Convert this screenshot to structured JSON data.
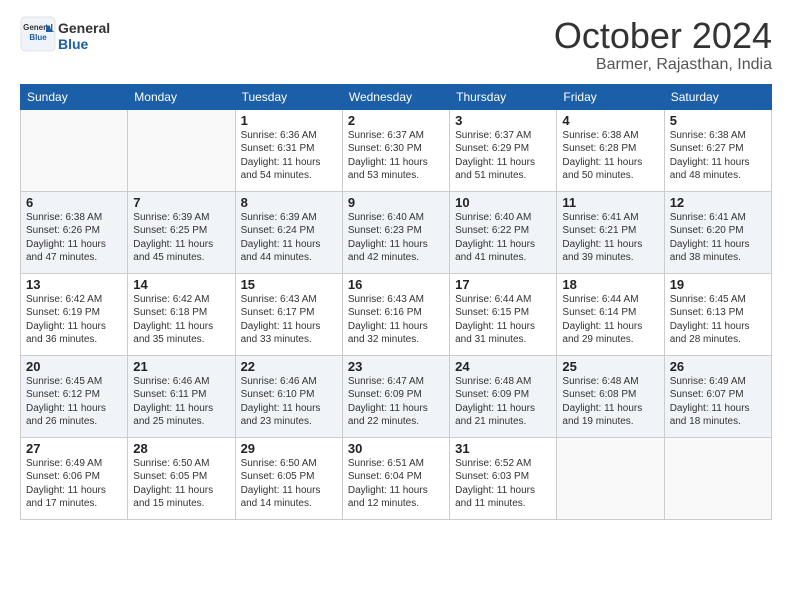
{
  "header": {
    "logo_general": "General",
    "logo_blue": "Blue",
    "month": "October 2024",
    "location": "Barmer, Rajasthan, India"
  },
  "weekdays": [
    "Sunday",
    "Monday",
    "Tuesday",
    "Wednesday",
    "Thursday",
    "Friday",
    "Saturday"
  ],
  "weeks": [
    [
      {
        "day": "",
        "sunrise": "",
        "sunset": "",
        "daylight": ""
      },
      {
        "day": "",
        "sunrise": "",
        "sunset": "",
        "daylight": ""
      },
      {
        "day": "1",
        "sunrise": "Sunrise: 6:36 AM",
        "sunset": "Sunset: 6:31 PM",
        "daylight": "Daylight: 11 hours and 54 minutes."
      },
      {
        "day": "2",
        "sunrise": "Sunrise: 6:37 AM",
        "sunset": "Sunset: 6:30 PM",
        "daylight": "Daylight: 11 hours and 53 minutes."
      },
      {
        "day": "3",
        "sunrise": "Sunrise: 6:37 AM",
        "sunset": "Sunset: 6:29 PM",
        "daylight": "Daylight: 11 hours and 51 minutes."
      },
      {
        "day": "4",
        "sunrise": "Sunrise: 6:38 AM",
        "sunset": "Sunset: 6:28 PM",
        "daylight": "Daylight: 11 hours and 50 minutes."
      },
      {
        "day": "5",
        "sunrise": "Sunrise: 6:38 AM",
        "sunset": "Sunset: 6:27 PM",
        "daylight": "Daylight: 11 hours and 48 minutes."
      }
    ],
    [
      {
        "day": "6",
        "sunrise": "Sunrise: 6:38 AM",
        "sunset": "Sunset: 6:26 PM",
        "daylight": "Daylight: 11 hours and 47 minutes."
      },
      {
        "day": "7",
        "sunrise": "Sunrise: 6:39 AM",
        "sunset": "Sunset: 6:25 PM",
        "daylight": "Daylight: 11 hours and 45 minutes."
      },
      {
        "day": "8",
        "sunrise": "Sunrise: 6:39 AM",
        "sunset": "Sunset: 6:24 PM",
        "daylight": "Daylight: 11 hours and 44 minutes."
      },
      {
        "day": "9",
        "sunrise": "Sunrise: 6:40 AM",
        "sunset": "Sunset: 6:23 PM",
        "daylight": "Daylight: 11 hours and 42 minutes."
      },
      {
        "day": "10",
        "sunrise": "Sunrise: 6:40 AM",
        "sunset": "Sunset: 6:22 PM",
        "daylight": "Daylight: 11 hours and 41 minutes."
      },
      {
        "day": "11",
        "sunrise": "Sunrise: 6:41 AM",
        "sunset": "Sunset: 6:21 PM",
        "daylight": "Daylight: 11 hours and 39 minutes."
      },
      {
        "day": "12",
        "sunrise": "Sunrise: 6:41 AM",
        "sunset": "Sunset: 6:20 PM",
        "daylight": "Daylight: 11 hours and 38 minutes."
      }
    ],
    [
      {
        "day": "13",
        "sunrise": "Sunrise: 6:42 AM",
        "sunset": "Sunset: 6:19 PM",
        "daylight": "Daylight: 11 hours and 36 minutes."
      },
      {
        "day": "14",
        "sunrise": "Sunrise: 6:42 AM",
        "sunset": "Sunset: 6:18 PM",
        "daylight": "Daylight: 11 hours and 35 minutes."
      },
      {
        "day": "15",
        "sunrise": "Sunrise: 6:43 AM",
        "sunset": "Sunset: 6:17 PM",
        "daylight": "Daylight: 11 hours and 33 minutes."
      },
      {
        "day": "16",
        "sunrise": "Sunrise: 6:43 AM",
        "sunset": "Sunset: 6:16 PM",
        "daylight": "Daylight: 11 hours and 32 minutes."
      },
      {
        "day": "17",
        "sunrise": "Sunrise: 6:44 AM",
        "sunset": "Sunset: 6:15 PM",
        "daylight": "Daylight: 11 hours and 31 minutes."
      },
      {
        "day": "18",
        "sunrise": "Sunrise: 6:44 AM",
        "sunset": "Sunset: 6:14 PM",
        "daylight": "Daylight: 11 hours and 29 minutes."
      },
      {
        "day": "19",
        "sunrise": "Sunrise: 6:45 AM",
        "sunset": "Sunset: 6:13 PM",
        "daylight": "Daylight: 11 hours and 28 minutes."
      }
    ],
    [
      {
        "day": "20",
        "sunrise": "Sunrise: 6:45 AM",
        "sunset": "Sunset: 6:12 PM",
        "daylight": "Daylight: 11 hours and 26 minutes."
      },
      {
        "day": "21",
        "sunrise": "Sunrise: 6:46 AM",
        "sunset": "Sunset: 6:11 PM",
        "daylight": "Daylight: 11 hours and 25 minutes."
      },
      {
        "day": "22",
        "sunrise": "Sunrise: 6:46 AM",
        "sunset": "Sunset: 6:10 PM",
        "daylight": "Daylight: 11 hours and 23 minutes."
      },
      {
        "day": "23",
        "sunrise": "Sunrise: 6:47 AM",
        "sunset": "Sunset: 6:09 PM",
        "daylight": "Daylight: 11 hours and 22 minutes."
      },
      {
        "day": "24",
        "sunrise": "Sunrise: 6:48 AM",
        "sunset": "Sunset: 6:09 PM",
        "daylight": "Daylight: 11 hours and 21 minutes."
      },
      {
        "day": "25",
        "sunrise": "Sunrise: 6:48 AM",
        "sunset": "Sunset: 6:08 PM",
        "daylight": "Daylight: 11 hours and 19 minutes."
      },
      {
        "day": "26",
        "sunrise": "Sunrise: 6:49 AM",
        "sunset": "Sunset: 6:07 PM",
        "daylight": "Daylight: 11 hours and 18 minutes."
      }
    ],
    [
      {
        "day": "27",
        "sunrise": "Sunrise: 6:49 AM",
        "sunset": "Sunset: 6:06 PM",
        "daylight": "Daylight: 11 hours and 17 minutes."
      },
      {
        "day": "28",
        "sunrise": "Sunrise: 6:50 AM",
        "sunset": "Sunset: 6:05 PM",
        "daylight": "Daylight: 11 hours and 15 minutes."
      },
      {
        "day": "29",
        "sunrise": "Sunrise: 6:50 AM",
        "sunset": "Sunset: 6:05 PM",
        "daylight": "Daylight: 11 hours and 14 minutes."
      },
      {
        "day": "30",
        "sunrise": "Sunrise: 6:51 AM",
        "sunset": "Sunset: 6:04 PM",
        "daylight": "Daylight: 11 hours and 12 minutes."
      },
      {
        "day": "31",
        "sunrise": "Sunrise: 6:52 AM",
        "sunset": "Sunset: 6:03 PM",
        "daylight": "Daylight: 11 hours and 11 minutes."
      },
      {
        "day": "",
        "sunrise": "",
        "sunset": "",
        "daylight": ""
      },
      {
        "day": "",
        "sunrise": "",
        "sunset": "",
        "daylight": ""
      }
    ]
  ]
}
